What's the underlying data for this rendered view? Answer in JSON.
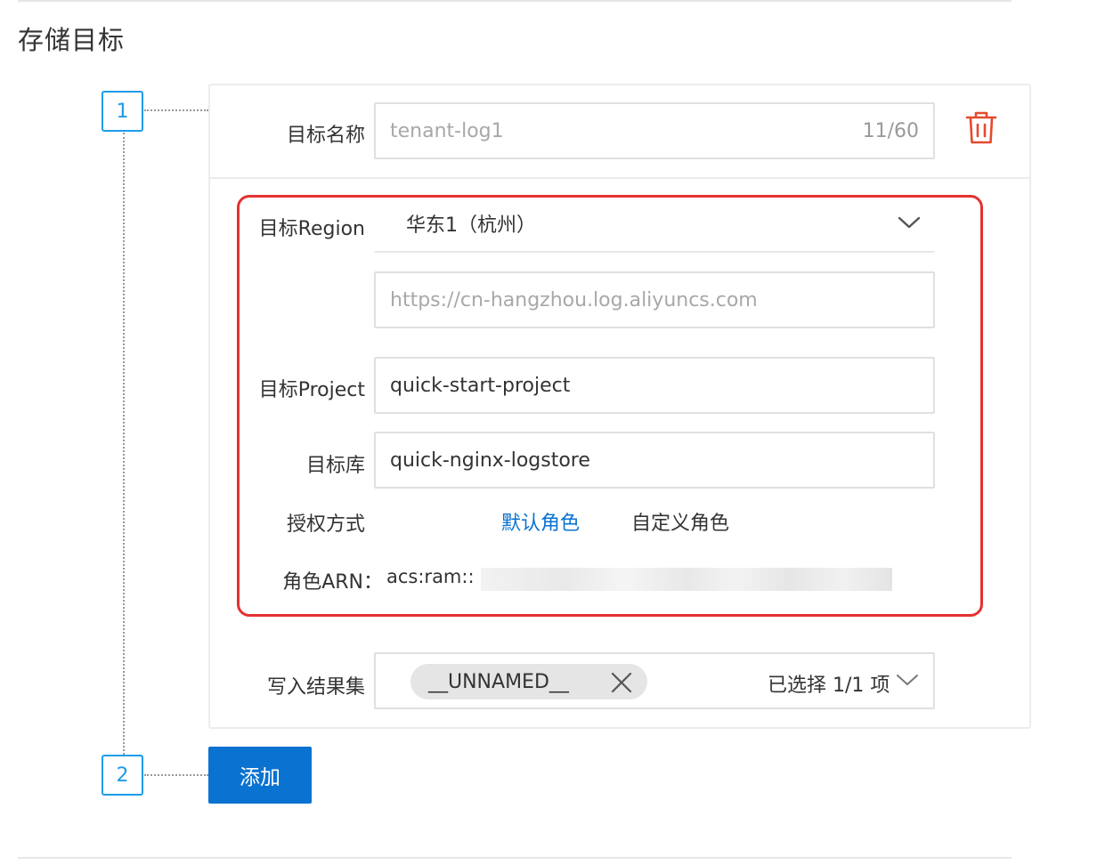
{
  "section_title": "存储目标",
  "steps": [
    "1",
    "2"
  ],
  "target_name": {
    "label": "目标名称",
    "value": "tenant-log1",
    "counter": "11/60"
  },
  "region": {
    "label": "目标Region",
    "value": "华东1（杭州）",
    "endpoint": "https://cn-hangzhou.log.aliyuncs.com"
  },
  "project": {
    "label": "目标Project",
    "value": "quick-start-project"
  },
  "logstore": {
    "label": "目标库",
    "value": "quick-nginx-logstore"
  },
  "auth": {
    "label": "授权方式",
    "options": [
      "默认角色",
      "自定义角色"
    ],
    "selected": "默认角色"
  },
  "role_arn": {
    "label": "角色ARN：",
    "value": "acs:ram::"
  },
  "result_set": {
    "label": "写入结果集",
    "tag": "__UNNAMED__",
    "summary": "已选择 1/1 项"
  },
  "add_button": "添加",
  "colors": {
    "accent": "#0a72d0",
    "link": "#0a72d0",
    "step_border": "#1e9bea",
    "highlight": "#e5312f",
    "delete_icon": "#e64a2e"
  },
  "icons": {
    "delete": "trash-icon",
    "dropdown": "chevron-down-icon",
    "remove_tag": "close-icon"
  }
}
